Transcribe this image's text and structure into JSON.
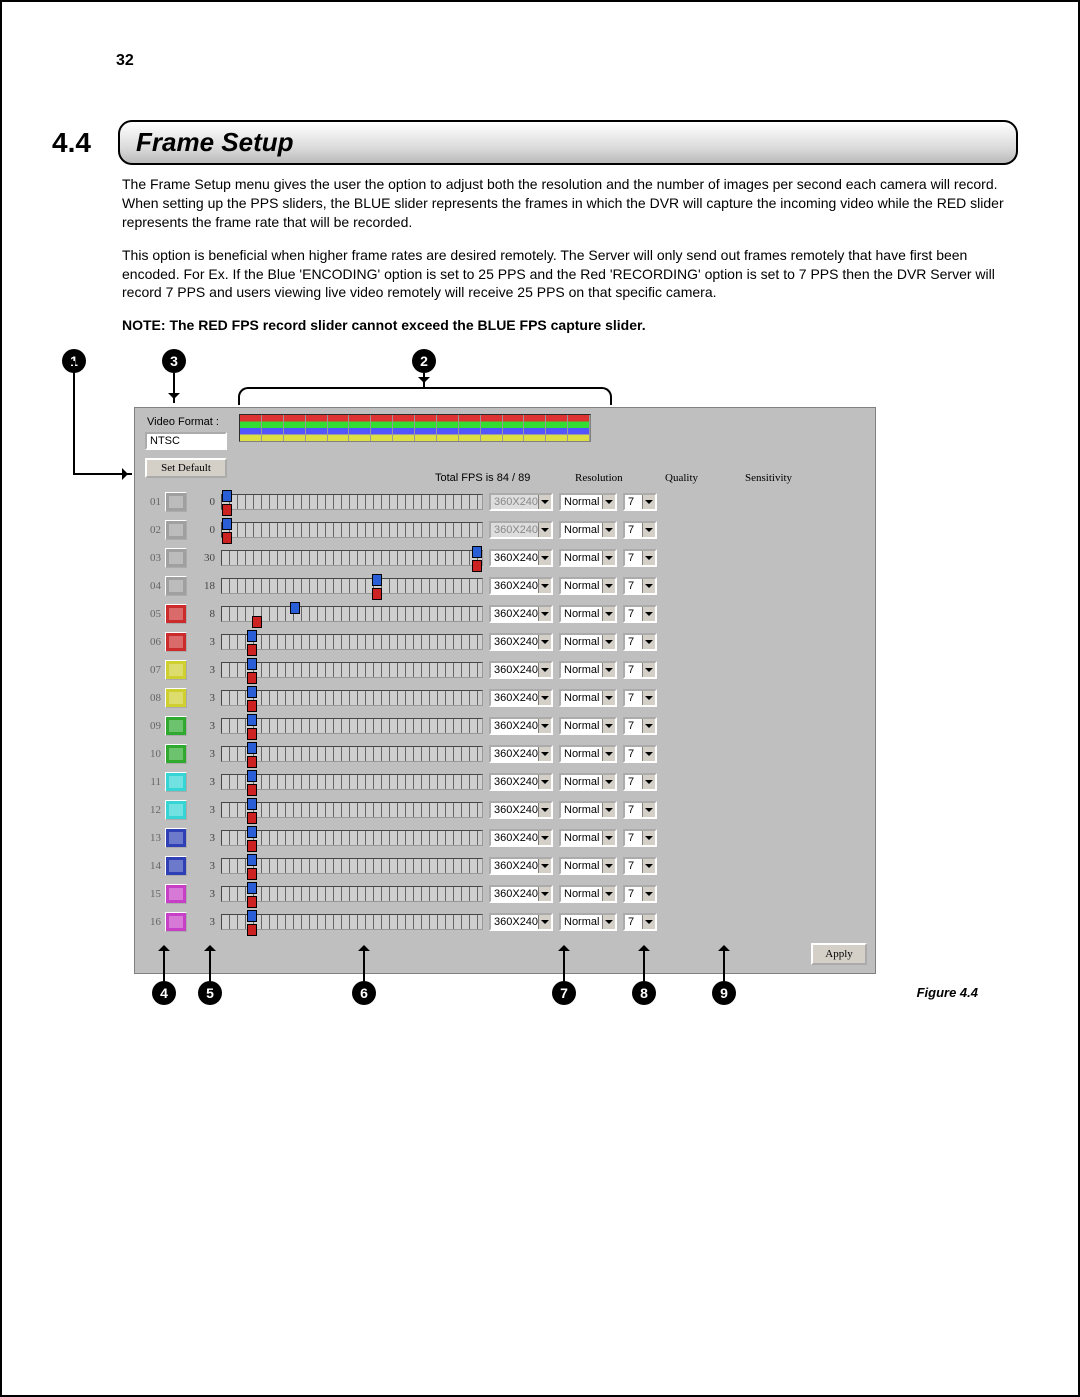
{
  "page_number": "32",
  "section_number": "4.4",
  "section_title": "Frame Setup",
  "paragraphs": {
    "p1": "The Frame Setup menu gives the user the option to adjust both the resolution and the number of images per second each camera will record. When setting up the PPS sliders, the BLUE slider represents the frames in which the DVR will capture the incoming video while the RED slider represents the frame rate that will be recorded.",
    "p2": "This option is beneficial when higher frame rates are desired remotely. The Server will only send out frames remotely that have first been encoded. For Ex. If the Blue 'ENCODING' option is set to 25 PPS and the Red 'RECORDING' option is set to 7 PPS then the DVR Server will record 7 PPS and users viewing live video remotely will receive 25 PPS on that specific camera.",
    "note": "NOTE: The RED FPS record slider cannot exceed the BLUE FPS capture slider."
  },
  "figure_caption": "Figure 4.4",
  "ui": {
    "video_format_label": "Video Format :",
    "video_format_value": "NTSC",
    "set_default": "Set Default",
    "total_fps": {
      "prefix": "Total FPS is ",
      "current": "84",
      "sep": " / ",
      "max": "89"
    },
    "headers": {
      "resolution": "Resolution",
      "quality": "Quality",
      "sensitivity": "Sensitivity"
    },
    "apply": "Apply",
    "channels": [
      {
        "ch": "01",
        "fps": "0",
        "cam": "#a0a0a0",
        "res": "360X240",
        "res_disabled": true,
        "qua": "Normal",
        "sen": "7",
        "blue": 0,
        "red": 0
      },
      {
        "ch": "02",
        "fps": "0",
        "cam": "#a0a0a0",
        "res": "360X240",
        "res_disabled": true,
        "qua": "Normal",
        "sen": "7",
        "blue": 0,
        "red": 0
      },
      {
        "ch": "03",
        "fps": "30",
        "cam": "#a0a0a0",
        "res": "360X240",
        "qua": "Normal",
        "sen": "7",
        "blue": 100,
        "red": 100
      },
      {
        "ch": "04",
        "fps": "18",
        "cam": "#a0a0a0",
        "res": "360X240",
        "qua": "Normal",
        "sen": "7",
        "blue": 60,
        "red": 60
      },
      {
        "ch": "05",
        "fps": "8",
        "cam": "#cc2b2b",
        "res": "360X240",
        "qua": "Normal",
        "sen": "7",
        "blue": 27,
        "red": 12
      },
      {
        "ch": "06",
        "fps": "3",
        "cam": "#cc2b2b",
        "res": "360X240",
        "qua": "Normal",
        "sen": "7",
        "blue": 10,
        "red": 10
      },
      {
        "ch": "07",
        "fps": "3",
        "cam": "#cfcf30",
        "res": "360X240",
        "qua": "Normal",
        "sen": "7",
        "blue": 10,
        "red": 10
      },
      {
        "ch": "08",
        "fps": "3",
        "cam": "#cfcf30",
        "res": "360X240",
        "qua": "Normal",
        "sen": "7",
        "blue": 10,
        "red": 10
      },
      {
        "ch": "09",
        "fps": "3",
        "cam": "#2faa2f",
        "res": "360X240",
        "qua": "Normal",
        "sen": "7",
        "blue": 10,
        "red": 10
      },
      {
        "ch": "10",
        "fps": "3",
        "cam": "#2faa2f",
        "res": "360X240",
        "qua": "Normal",
        "sen": "7",
        "blue": 10,
        "red": 10
      },
      {
        "ch": "11",
        "fps": "3",
        "cam": "#36d4d4",
        "res": "360X240",
        "qua": "Normal",
        "sen": "7",
        "blue": 10,
        "red": 10
      },
      {
        "ch": "12",
        "fps": "3",
        "cam": "#36d4d4",
        "res": "360X240",
        "qua": "Normal",
        "sen": "7",
        "blue": 10,
        "red": 10
      },
      {
        "ch": "13",
        "fps": "3",
        "cam": "#2f3fb5",
        "res": "360X240",
        "qua": "Normal",
        "sen": "7",
        "blue": 10,
        "red": 10
      },
      {
        "ch": "14",
        "fps": "3",
        "cam": "#2f3fb5",
        "res": "360X240",
        "qua": "Normal",
        "sen": "7",
        "blue": 10,
        "red": 10
      },
      {
        "ch": "15",
        "fps": "3",
        "cam": "#c63fc6",
        "res": "360X240",
        "qua": "Normal",
        "sen": "7",
        "blue": 10,
        "red": 10
      },
      {
        "ch": "16",
        "fps": "3",
        "cam": "#c63fc6",
        "res": "360X240",
        "qua": "Normal",
        "sen": "7",
        "blue": 10,
        "red": 10
      }
    ]
  },
  "callouts": {
    "1": "1",
    "2": "2",
    "3": "3",
    "4": "4",
    "5": "5",
    "6": "6",
    "7": "7",
    "8": "8",
    "9": "9"
  }
}
